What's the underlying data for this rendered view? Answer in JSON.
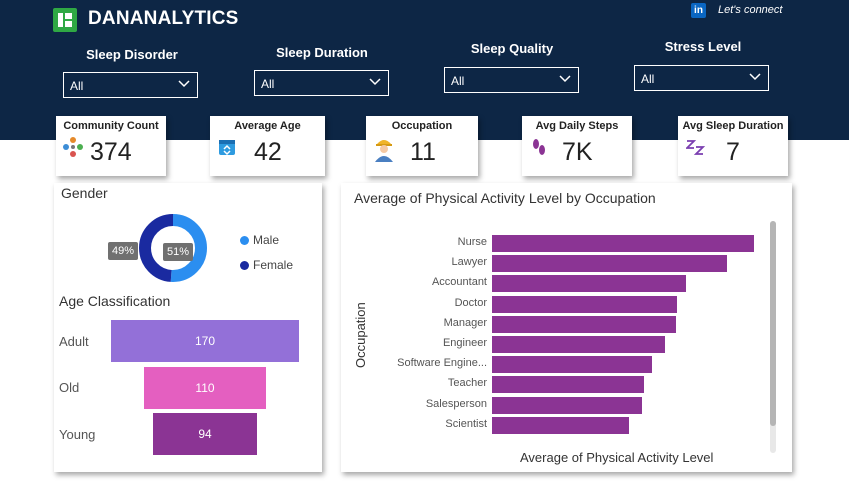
{
  "header": {
    "brand": "DANANALYTICS",
    "connect_text": "Let's connect",
    "linkedin_glyph": "in"
  },
  "slicers": [
    {
      "title": "Sleep Disorder",
      "value": "All"
    },
    {
      "title": "Sleep Duration",
      "value": "All"
    },
    {
      "title": "Sleep Quality",
      "value": "All"
    },
    {
      "title": "Stress Level",
      "value": "All"
    }
  ],
  "kpis": [
    {
      "title": "Community Count",
      "value": "374",
      "icon": "community-icon"
    },
    {
      "title": "Average Age",
      "value": "42",
      "icon": "calendar-icon"
    },
    {
      "title": "Occupation",
      "value": "11",
      "icon": "worker-icon"
    },
    {
      "title": "Avg Daily Steps",
      "value": "7K",
      "icon": "footsteps-icon"
    },
    {
      "title": "Avg Sleep Duration",
      "value": "7",
      "icon": "sleep-zz-icon"
    }
  ],
  "gender": {
    "title": "Gender",
    "legend": [
      {
        "label": "Male",
        "color": "#2b8ef0"
      },
      {
        "label": "Female",
        "color": "#1a2aa0"
      }
    ],
    "female_pct_label": "49%",
    "male_pct_label": "51%",
    "female_share": 0.49,
    "male_share": 0.51
  },
  "age": {
    "title": "Age Classification",
    "rows": [
      {
        "label": "Adult",
        "value": "170",
        "color": "#9370d8"
      },
      {
        "label": "Old",
        "value": "110",
        "color": "#e45fc0"
      },
      {
        "label": "Young",
        "value": "94",
        "color": "#8b3494"
      }
    ]
  },
  "chart_data": {
    "type": "bar",
    "orientation": "horizontal",
    "title": "Average of Physical Activity Level by Occupation",
    "xlabel": "Average of Physical Activity Level",
    "ylabel": "Occupation",
    "categories": [
      "Nurse",
      "Lawyer",
      "Accountant",
      "Doctor",
      "Manager",
      "Engineer",
      "Software Engine...",
      "Teacher",
      "Salesperson",
      "Scientist"
    ],
    "values": [
      78.6,
      70.4,
      58.1,
      55.4,
      55,
      51.9,
      48,
      45.6,
      45,
      41
    ],
    "xlim": [
      0,
      80
    ],
    "bar_color": "#8b3494",
    "grid": false
  }
}
